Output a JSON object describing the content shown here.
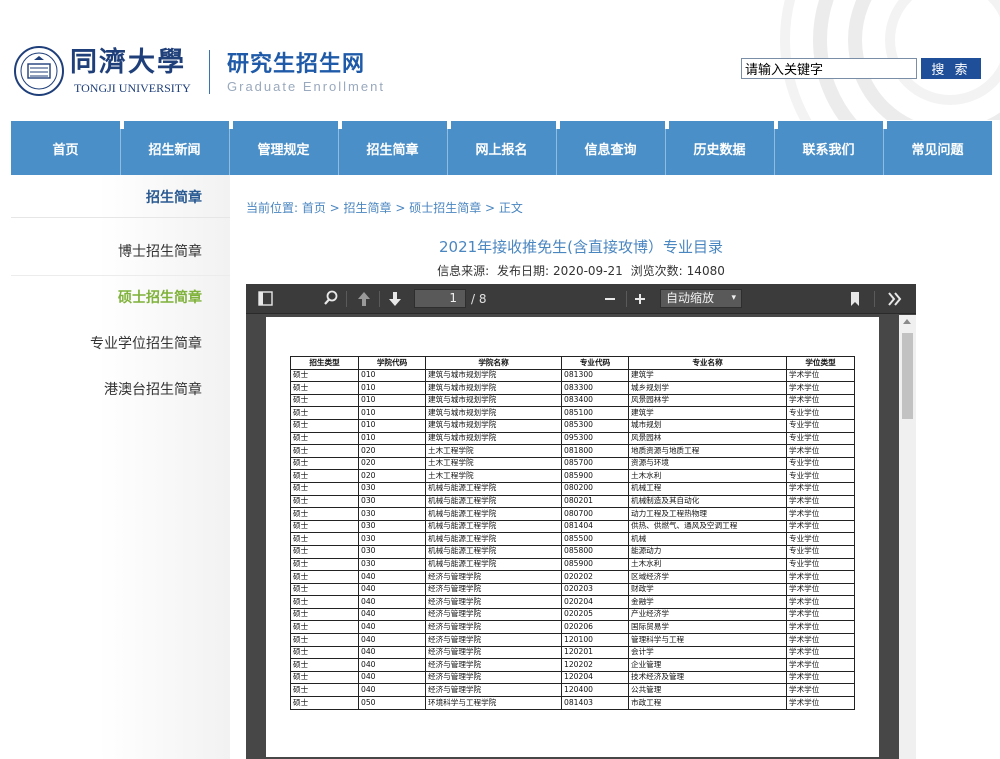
{
  "header": {
    "logo_cn": "同濟大學",
    "logo_en": "TONGJI UNIVERSITY",
    "site_title": "研究生招生网",
    "site_subtitle": "Graduate Enrollment",
    "search_value": "请输入关键字",
    "search_button": "搜 索"
  },
  "nav": {
    "items": [
      "首页",
      "招生新闻",
      "管理规定",
      "招生简章",
      "网上报名",
      "信息查询",
      "历史数据",
      "联系我们",
      "常见问题"
    ]
  },
  "sidebar": {
    "title": "招生简章",
    "items": [
      {
        "label": "博士招生简章",
        "active": false
      },
      {
        "label": "硕士招生简章",
        "active": true
      },
      {
        "label": "专业学位招生简章",
        "active": false
      },
      {
        "label": "港澳台招生简章",
        "active": false
      }
    ]
  },
  "article": {
    "breadcrumb": "当前位置:  首页 > 招生简章 > 硕士招生简章 > 正文",
    "title": "2021年接收推免生(含直接攻博）专业目录",
    "source_label": "信息来源:",
    "date_label": "发布日期:",
    "date": "2020-09-21",
    "views_label": "浏览次数:",
    "views": "14080"
  },
  "pdf_viewer": {
    "page_current": "1",
    "page_total": "/ 8",
    "zoom": "自动缩放",
    "table": {
      "headers": [
        "招生类型",
        "学院代码",
        "学院名称",
        "专业代码",
        "专业名称",
        "学位类型"
      ],
      "rows": [
        [
          "硕士",
          "010",
          "建筑与城市规划学院",
          "081300",
          "建筑学",
          "学术学位"
        ],
        [
          "硕士",
          "010",
          "建筑与城市规划学院",
          "083300",
          "城乡规划学",
          "学术学位"
        ],
        [
          "硕士",
          "010",
          "建筑与城市规划学院",
          "083400",
          "风景园林学",
          "学术学位"
        ],
        [
          "硕士",
          "010",
          "建筑与城市规划学院",
          "085100",
          "建筑学",
          "专业学位"
        ],
        [
          "硕士",
          "010",
          "建筑与城市规划学院",
          "085300",
          "城市规划",
          "专业学位"
        ],
        [
          "硕士",
          "010",
          "建筑与城市规划学院",
          "095300",
          "风景园林",
          "专业学位"
        ],
        [
          "硕士",
          "020",
          "土木工程学院",
          "081800",
          "地质资源与地质工程",
          "学术学位"
        ],
        [
          "硕士",
          "020",
          "土木工程学院",
          "085700",
          "资源与环境",
          "专业学位"
        ],
        [
          "硕士",
          "020",
          "土木工程学院",
          "085900",
          "土木水利",
          "专业学位"
        ],
        [
          "硕士",
          "030",
          "机械与能源工程学院",
          "080200",
          "机械工程",
          "学术学位"
        ],
        [
          "硕士",
          "030",
          "机械与能源工程学院",
          "080201",
          "机械制造及其自动化",
          "学术学位"
        ],
        [
          "硕士",
          "030",
          "机械与能源工程学院",
          "080700",
          "动力工程及工程热物理",
          "学术学位"
        ],
        [
          "硕士",
          "030",
          "机械与能源工程学院",
          "081404",
          "供热、供燃气、通风及空调工程",
          "学术学位"
        ],
        [
          "硕士",
          "030",
          "机械与能源工程学院",
          "085500",
          "机械",
          "专业学位"
        ],
        [
          "硕士",
          "030",
          "机械与能源工程学院",
          "085800",
          "能源动力",
          "专业学位"
        ],
        [
          "硕士",
          "030",
          "机械与能源工程学院",
          "085900",
          "土木水利",
          "专业学位"
        ],
        [
          "硕士",
          "040",
          "经济与管理学院",
          "020202",
          "区域经济学",
          "学术学位"
        ],
        [
          "硕士",
          "040",
          "经济与管理学院",
          "020203",
          "财政学",
          "学术学位"
        ],
        [
          "硕士",
          "040",
          "经济与管理学院",
          "020204",
          "金融学",
          "学术学位"
        ],
        [
          "硕士",
          "040",
          "经济与管理学院",
          "020205",
          "产业经济学",
          "学术学位"
        ],
        [
          "硕士",
          "040",
          "经济与管理学院",
          "020206",
          "国际贸易学",
          "学术学位"
        ],
        [
          "硕士",
          "040",
          "经济与管理学院",
          "120100",
          "管理科学与工程",
          "学术学位"
        ],
        [
          "硕士",
          "040",
          "经济与管理学院",
          "120201",
          "会计学",
          "学术学位"
        ],
        [
          "硕士",
          "040",
          "经济与管理学院",
          "120202",
          "企业管理",
          "学术学位"
        ],
        [
          "硕士",
          "040",
          "经济与管理学院",
          "120204",
          "技术经济及管理",
          "学术学位"
        ],
        [
          "硕士",
          "040",
          "经济与管理学院",
          "120400",
          "公共管理",
          "学术学位"
        ],
        [
          "硕士",
          "050",
          "环境科学与工程学院",
          "081403",
          "市政工程",
          "学术学位"
        ]
      ]
    }
  },
  "colors": {
    "nav_bg": "#4a8fc8",
    "brand_blue": "#1f4f98",
    "active_green": "#7fb23a",
    "link_blue": "#4a86c0"
  }
}
